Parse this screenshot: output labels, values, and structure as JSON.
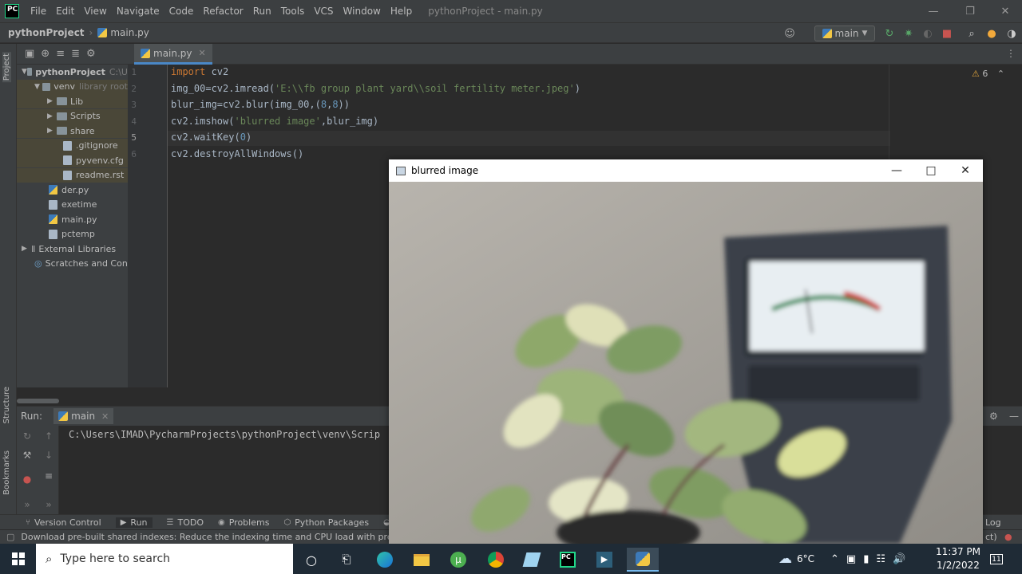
{
  "menubar": {
    "logo": "PC",
    "items": [
      "File",
      "Edit",
      "View",
      "Navigate",
      "Code",
      "Refactor",
      "Run",
      "Tools",
      "VCS",
      "Window",
      "Help"
    ],
    "window_title": "pythonProject - main.py",
    "controls": [
      "minimize-icon",
      "restore-icon",
      "close-icon"
    ]
  },
  "navbar": {
    "project": "pythonProject",
    "file": "main.py",
    "run_config": "main"
  },
  "left_stripe": {
    "project_label": "Project",
    "structure_label": "Structure",
    "bookmarks_label": "Bookmarks"
  },
  "project_tree": {
    "root": "pythonProject",
    "root_path": "C:\\U",
    "items": [
      {
        "label": "venv",
        "hint": "library root"
      },
      {
        "label": "Lib"
      },
      {
        "label": "Scripts"
      },
      {
        "label": "share"
      },
      {
        "label": ".gitignore"
      },
      {
        "label": "pyvenv.cfg"
      },
      {
        "label": "readme.rst"
      },
      {
        "label": "der.py"
      },
      {
        "label": "exetime"
      },
      {
        "label": "main.py"
      },
      {
        "label": "pctemp"
      },
      {
        "label": "External Libraries"
      },
      {
        "label": "Scratches and Conso"
      }
    ]
  },
  "editor": {
    "tab_label": "main.py",
    "line_numbers": [
      "1",
      "2",
      "3",
      "4",
      "5",
      "6"
    ],
    "warnings_count": "6",
    "code": {
      "l1_kw": "import",
      "l1_rest": " cv2",
      "l2_a": "img_00=cv2.imread(",
      "l2_str": "'E:\\\\fb group plant yard\\\\soil fertility meter.jpeg'",
      "l2_b": ")",
      "l3_a": "blur_img=cv2.blur(img_00,(",
      "l3_n1": "8",
      "l3_comma": ",",
      "l3_n2": "8",
      "l3_b": "))",
      "l4_a": "cv2.imshow(",
      "l4_str": "'blurred image'",
      "l4_b": ",blur_img)",
      "l5_a": "cv2.waitKey(",
      "l5_num": "0",
      "l5_b": ")",
      "l6": "cv2.destroyAllWindows()"
    }
  },
  "run_panel": {
    "label": "Run:",
    "config": "main",
    "console_line": "C:\\Users\\IMAD\\PycharmProjects\\pythonProject\\venv\\Scrip"
  },
  "bottom_tabs": [
    "Version Control",
    "Run",
    "TODO",
    "Problems",
    "Python Packages",
    "Py"
  ],
  "bottom_right": "Log",
  "status_text": "Download pre-built shared indexes: Reduce the indexing time and CPU load with pre-built Py",
  "status_right": "ct)",
  "cv_window": {
    "title": "blurred image"
  },
  "taskbar": {
    "search_placeholder": "Type here to search",
    "weather": "6°C",
    "time": "11:37 PM",
    "date": "1/2/2022",
    "notifications": "11"
  },
  "colors": {
    "ide_bg": "#2b2b2b",
    "panel_bg": "#3c3f41",
    "keyword": "#cc7832",
    "string": "#6a8759",
    "number": "#6897bb",
    "taskbar_bg": "#1f2b36"
  }
}
